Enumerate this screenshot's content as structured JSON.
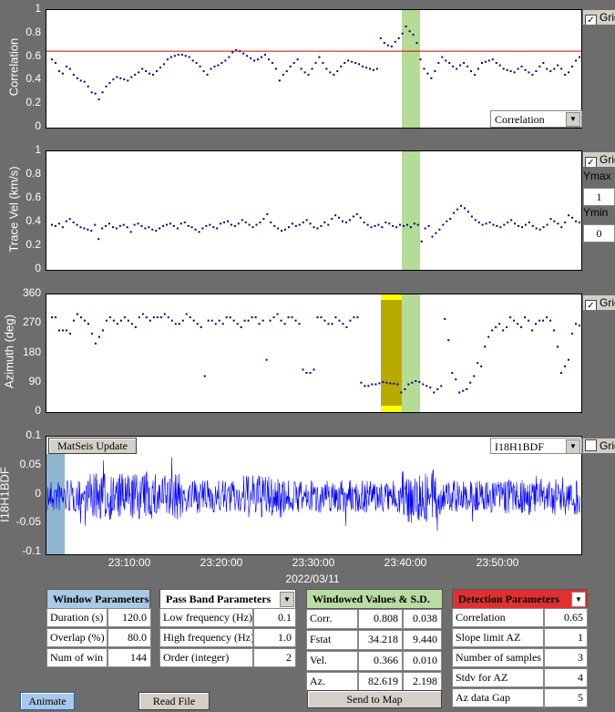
{
  "panels": {
    "correlation": {
      "ylabel": "Correlation",
      "yticks": [
        "1",
        "0.8",
        "0.6",
        "0.4",
        "0.2",
        "0"
      ],
      "grid_label": "Grid",
      "grid_checked": true,
      "dropdown": "Correlation",
      "threshold": 0.65,
      "values": [
        0.58,
        0.55,
        0.48,
        0.46,
        0.52,
        0.5,
        0.45,
        0.42,
        0.4,
        0.39,
        0.35,
        0.3,
        0.29,
        0.24,
        0.3,
        0.35,
        0.38,
        0.41,
        0.43,
        0.42,
        0.41,
        0.4,
        0.43,
        0.45,
        0.47,
        0.5,
        0.48,
        0.46,
        0.45,
        0.48,
        0.51,
        0.54,
        0.58,
        0.6,
        0.61,
        0.62,
        0.62,
        0.61,
        0.6,
        0.57,
        0.55,
        0.52,
        0.48,
        0.45,
        0.5,
        0.52,
        0.53,
        0.55,
        0.57,
        0.6,
        0.64,
        0.66,
        0.65,
        0.63,
        0.61,
        0.59,
        0.57,
        0.58,
        0.6,
        0.62,
        0.58,
        0.55,
        0.5,
        0.4,
        0.45,
        0.48,
        0.52,
        0.55,
        0.58,
        0.5,
        0.47,
        0.45,
        0.5,
        0.55,
        0.6,
        0.55,
        0.5,
        0.47,
        0.45,
        0.48,
        0.52,
        0.55,
        0.57,
        0.56,
        0.55,
        0.54,
        0.52,
        0.51,
        0.5,
        0.49,
        0.5,
        0.76,
        0.72,
        0.7,
        0.69,
        0.73,
        0.76,
        0.8,
        0.86,
        0.82,
        0.79,
        0.72,
        0.58,
        0.5,
        0.46,
        0.42,
        0.48,
        0.55,
        0.6,
        0.57,
        0.55,
        0.52,
        0.5,
        0.53,
        0.55,
        0.52,
        0.48,
        0.45,
        0.5,
        0.55,
        0.56,
        0.57,
        0.58,
        0.55,
        0.53,
        0.5,
        0.49,
        0.48,
        0.47,
        0.5,
        0.52,
        0.49,
        0.47,
        0.45,
        0.48,
        0.52,
        0.55,
        0.5,
        0.48,
        0.5,
        0.53,
        0.5,
        0.45,
        0.47,
        0.52,
        0.57,
        0.6
      ]
    },
    "tracevel": {
      "ylabel": "Trace Vel (km/s)",
      "yticks": [
        "1",
        "0.8",
        "0.6",
        "0.4",
        "0.2",
        "0"
      ],
      "grid_label": "Grid",
      "grid_checked": true,
      "ymax_label": "Ymax",
      "ymax_value": "1",
      "ymin_label": "Ymin",
      "ymin_value": "0",
      "values": [
        0.38,
        0.37,
        0.39,
        0.36,
        0.41,
        0.43,
        0.4,
        0.38,
        0.36,
        0.35,
        0.34,
        0.33,
        0.38,
        0.26,
        0.35,
        0.37,
        0.39,
        0.36,
        0.35,
        0.37,
        0.38,
        0.36,
        0.32,
        0.38,
        0.39,
        0.37,
        0.35,
        0.36,
        0.34,
        0.33,
        0.35,
        0.37,
        0.38,
        0.39,
        0.37,
        0.35,
        0.39,
        0.4,
        0.37,
        0.36,
        0.34,
        0.32,
        0.35,
        0.37,
        0.38,
        0.36,
        0.35,
        0.39,
        0.4,
        0.41,
        0.38,
        0.37,
        0.39,
        0.42,
        0.4,
        0.38,
        0.36,
        0.38,
        0.4,
        0.43,
        0.47,
        0.4,
        0.37,
        0.35,
        0.33,
        0.34,
        0.36,
        0.39,
        0.37,
        0.38,
        0.4,
        0.42,
        0.39,
        0.36,
        0.35,
        0.37,
        0.4,
        0.38,
        0.43,
        0.46,
        0.44,
        0.41,
        0.4,
        0.42,
        0.45,
        0.47,
        0.44,
        0.4,
        0.38,
        0.36,
        0.37,
        0.38,
        0.36,
        0.4,
        0.39,
        0.37,
        0.36,
        0.38,
        0.37,
        0.38,
        0.36,
        0.39,
        0.38,
        0.24,
        0.35,
        0.37,
        0.28,
        0.31,
        0.34,
        0.38,
        0.41,
        0.43,
        0.48,
        0.51,
        0.54,
        0.52,
        0.49,
        0.45,
        0.42,
        0.4,
        0.38,
        0.39,
        0.4,
        0.38,
        0.37,
        0.36,
        0.38,
        0.4,
        0.42,
        0.39,
        0.37,
        0.36,
        0.38,
        0.4,
        0.37,
        0.35,
        0.34,
        0.36,
        0.38,
        0.43,
        0.41,
        0.39,
        0.36,
        0.4,
        0.46,
        0.44,
        0.41,
        0.4
      ]
    },
    "azimuth": {
      "ylabel": "Azimuth (deg)",
      "yticks": [
        "360",
        "270",
        "180",
        "90",
        "0"
      ],
      "grid_label": "Grid",
      "grid_checked": true,
      "values": [
        290,
        290,
        250,
        250,
        250,
        240,
        280,
        300,
        290,
        280,
        270,
        240,
        210,
        230,
        250,
        280,
        290,
        280,
        270,
        280,
        290,
        280,
        270,
        260,
        290,
        300,
        290,
        280,
        290,
        290,
        290,
        300,
        290,
        280,
        270,
        270,
        280,
        300,
        290,
        280,
        270,
        260,
        110,
        280,
        280,
        270,
        280,
        270,
        290,
        290,
        280,
        270,
        260,
        280,
        280,
        290,
        290,
        270,
        280,
        160,
        280,
        290,
        300,
        280,
        270,
        290,
        290,
        280,
        270,
        130,
        120,
        120,
        130,
        290,
        290,
        280,
        270,
        270,
        290,
        280,
        270,
        260,
        280,
        290,
        290,
        90,
        80,
        80,
        85,
        85,
        88,
        92,
        90,
        88,
        87,
        85,
        60,
        70,
        85,
        90,
        95,
        92,
        85,
        80,
        75,
        60,
        70,
        80,
        285,
        220,
        120,
        100,
        60,
        65,
        70,
        90,
        110,
        150,
        140,
        200,
        230,
        250,
        260,
        270,
        250,
        260,
        290,
        280,
        270,
        260,
        290,
        280,
        250,
        270,
        280,
        280,
        290,
        280,
        250,
        200,
        120,
        140,
        160,
        240,
        270,
        265
      ]
    },
    "waveform": {
      "ylabel": "I18H1BDF",
      "yticks": [
        "0.1",
        "0.05",
        "0",
        "-0.05",
        "-0.1"
      ],
      "grid_label": "Grid",
      "grid_checked": false,
      "matseis_button": "MatSeis Update",
      "station_dropdown": "I18H1BDF",
      "xticks": [
        "23:10:00",
        "23:20:00",
        "23:30:00",
        "23:40:00",
        "23:50:00"
      ],
      "date_label": "2022/03/11"
    }
  },
  "window_params": {
    "title": "Window Parameters",
    "rows": [
      {
        "label": "Duration (s)",
        "value": "120.0"
      },
      {
        "label": "Overlap (%)",
        "value": "80.0"
      },
      {
        "label": "Num of win",
        "value": "144"
      }
    ]
  },
  "passband_params": {
    "title": "Pass Band Parameters",
    "rows": [
      {
        "label": "Low frequency (Hz)",
        "value": "0.1"
      },
      {
        "label": "High frequency (Hz)",
        "value": "1.0"
      },
      {
        "label": "Order (integer)",
        "value": "2"
      }
    ]
  },
  "windowed_values": {
    "title": "Windowed Values & S.D.",
    "rows": [
      {
        "label": "Corr.",
        "value": "0.808",
        "sd": "0.038"
      },
      {
        "label": "Fstat",
        "value": "34.218",
        "sd": "9.440"
      },
      {
        "label": "Vel.",
        "value": "0.366",
        "sd": "0.010"
      },
      {
        "label": "Az.",
        "value": "82.619",
        "sd": "2.198"
      }
    ],
    "send_button": "Send to Map"
  },
  "detection_params": {
    "title": "Detection Parameters",
    "rows": [
      {
        "label": "Correlation",
        "value": "0.65"
      },
      {
        "label": "Slope limit AZ",
        "value": "1"
      },
      {
        "label": "Number of samples",
        "value": "3"
      },
      {
        "label": "Stdv for AZ",
        "value": "4"
      },
      {
        "label": "Az data Gap",
        "value": "5"
      }
    ]
  },
  "buttons": {
    "animate": "Animate",
    "read_file": "Read File"
  },
  "colors": {
    "highlight_green": "#b5dc96",
    "highlight_olive": "#b8aa00",
    "highlight_yellow": "#ffff00",
    "waveform_blue": "#0000ff",
    "point_navy": "#000080",
    "threshold_red": "#d00000",
    "header_blue": "#a9c9e5",
    "header_green": "#b9dca3",
    "header_red": "#e03030"
  }
}
